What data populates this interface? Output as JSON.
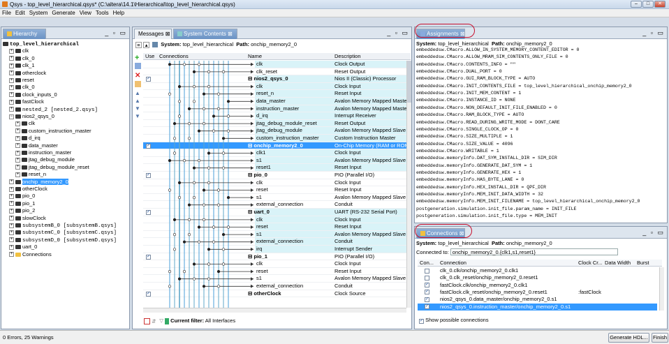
{
  "window": {
    "title": "Qsys - top_level_hierarchical.qsys* (C:\\altera\\14.1\\Hierarchical\\top_level_hierarchical.qsys)",
    "min": "–",
    "max": "□",
    "close": "✕"
  },
  "menu": [
    "File",
    "Edit",
    "System",
    "Generate",
    "View",
    "Tools",
    "Help"
  ],
  "hierarchy": {
    "tab": "Hierarchy",
    "items": [
      {
        "label": "top_level_hierarchical",
        "level": 0,
        "bold": true
      },
      {
        "label": "clk",
        "level": 1
      },
      {
        "label": "clk_0",
        "level": 1
      },
      {
        "label": "clk_1",
        "level": 1
      },
      {
        "label": "otherclock",
        "level": 1
      },
      {
        "label": "reset",
        "level": 1
      },
      {
        "label": "clk_0",
        "level": 1
      },
      {
        "label": "clock_inputs_0",
        "level": 1
      },
      {
        "label": "fastClock",
        "level": 1
      },
      {
        "label": "nested_2 [nested_2.qsys]",
        "level": 1,
        "mono": true
      },
      {
        "label": "nios2_qsys_0",
        "level": 1
      },
      {
        "label": "clk",
        "level": 2
      },
      {
        "label": "custom_instruction_master",
        "level": 2
      },
      {
        "label": "d_irq",
        "level": 2
      },
      {
        "label": "data_master",
        "level": 2
      },
      {
        "label": "instruction_master",
        "level": 2
      },
      {
        "label": "jtag_debug_module",
        "level": 2
      },
      {
        "label": "jtag_debug_module_reset",
        "level": 2
      },
      {
        "label": "reset_n",
        "level": 2
      },
      {
        "label": "onchip_memory2_0",
        "level": 1,
        "selected": true
      },
      {
        "label": "otherClock",
        "level": 1
      },
      {
        "label": "pio_0",
        "level": 1
      },
      {
        "label": "pio_1",
        "level": 1
      },
      {
        "label": "pio_2",
        "level": 1
      },
      {
        "label": "slowClock",
        "level": 1
      },
      {
        "label": "subsystemB_0 [subsystemB.qsys]",
        "level": 1,
        "mono": true
      },
      {
        "label": "subsystemC_0 [subsystemC.qsys]",
        "level": 1,
        "mono": true
      },
      {
        "label": "subsystemD_0 [subsystemD.qsys]",
        "level": 1,
        "mono": true
      },
      {
        "label": "uart_0",
        "level": 1
      },
      {
        "label": "Connections",
        "level": 1
      }
    ]
  },
  "contents": {
    "tab_messages": "Messages",
    "tab_system": "System Contents",
    "system_label": "System:",
    "system_value": "top_level_hierarchical",
    "path_label": "Path:",
    "path_value": "onchip_memory2_0",
    "col_use": "Use",
    "col_connections": "Connections",
    "col_name": "Name",
    "col_description": "Description",
    "rows": [
      {
        "use": "",
        "name": "clk",
        "desc": "Clock Output",
        "indent": true,
        "band": true
      },
      {
        "use": "",
        "name": "clk_reset",
        "desc": "Reset Output",
        "indent": true,
        "band": false
      },
      {
        "use": "✓",
        "name": "nios2_qsys_0",
        "desc": "Nios II (Classic) Processor",
        "bold": true,
        "band": true
      },
      {
        "use": "",
        "name": "clk",
        "desc": "Clock Input",
        "indent": true,
        "band": true
      },
      {
        "use": "",
        "name": "reset_n",
        "desc": "Reset Input",
        "indent": true,
        "band": true
      },
      {
        "use": "",
        "name": "data_master",
        "desc": "Avalon Memory Mapped Master",
        "indent": true,
        "band": true
      },
      {
        "use": "",
        "name": "instruction_master",
        "desc": "Avalon Memory Mapped Master",
        "indent": true,
        "band": true
      },
      {
        "use": "",
        "name": "d_irq",
        "desc": "Interrupt Receiver",
        "indent": true,
        "band": true
      },
      {
        "use": "",
        "name": "jtag_debug_module_reset",
        "desc": "Reset Output",
        "indent": true,
        "band": true
      },
      {
        "use": "",
        "name": "jtag_debug_module",
        "desc": "Avalon Memory Mapped Slave",
        "indent": true,
        "band": true
      },
      {
        "use": "",
        "name": "custom_instruction_master",
        "desc": "Custom Instruction Master",
        "indent": true,
        "band": true
      },
      {
        "use": "✓",
        "name": "onchip_memory2_0",
        "desc": "On-Chip Memory (RAM or ROM)",
        "bold": true,
        "selected": true
      },
      {
        "use": "",
        "name": "clk1",
        "desc": "Clock Input",
        "indent": true,
        "band": true
      },
      {
        "use": "",
        "name": "s1",
        "desc": "Avalon Memory Mapped Slave",
        "indent": true,
        "band": true
      },
      {
        "use": "",
        "name": "reset1",
        "desc": "Reset Input",
        "indent": true,
        "band": true
      },
      {
        "use": "✓",
        "name": "pio_0",
        "desc": "PIO (Parallel I/O)",
        "bold": true,
        "band": false
      },
      {
        "use": "",
        "name": "clk",
        "desc": "Clock Input",
        "indent": true,
        "band": false
      },
      {
        "use": "",
        "name": "reset",
        "desc": "Reset Input",
        "indent": true,
        "band": false
      },
      {
        "use": "",
        "name": "s1",
        "desc": "Avalon Memory Mapped Slave",
        "indent": true,
        "band": false
      },
      {
        "use": "",
        "name": "external_connection",
        "desc": "Conduit",
        "indent": true,
        "band": false
      },
      {
        "use": "✓",
        "name": "uart_0",
        "desc": "UART (RS-232 Serial Port)",
        "bold": true,
        "band": true
      },
      {
        "use": "",
        "name": "clk",
        "desc": "Clock Input",
        "indent": true,
        "band": true
      },
      {
        "use": "",
        "name": "reset",
        "desc": "Reset Input",
        "indent": true,
        "band": true
      },
      {
        "use": "",
        "name": "s1",
        "desc": "Avalon Memory Mapped Slave",
        "indent": true,
        "band": true
      },
      {
        "use": "",
        "name": "external_connection",
        "desc": "Conduit",
        "indent": true,
        "band": true
      },
      {
        "use": "",
        "name": "irq",
        "desc": "Interrupt Sender",
        "indent": true,
        "band": true
      },
      {
        "use": "✓",
        "name": "pio_1",
        "desc": "PIO (Parallel I/O)",
        "bold": true,
        "band": false
      },
      {
        "use": "",
        "name": "clk",
        "desc": "Clock Input",
        "indent": true,
        "band": false
      },
      {
        "use": "",
        "name": "reset",
        "desc": "Reset Input",
        "indent": true,
        "band": false
      },
      {
        "use": "",
        "name": "s1",
        "desc": "Avalon Memory Mapped Slave",
        "indent": true,
        "band": false
      },
      {
        "use": "",
        "name": "external_connection",
        "desc": "Conduit",
        "indent": true,
        "band": false
      },
      {
        "use": "✓",
        "name": "otherClock",
        "desc": "Clock Source",
        "bold": true,
        "band": false
      }
    ],
    "filter_label": "Current filter:",
    "filter_value": "All Interfaces"
  },
  "assignments": {
    "tab": "Assignments",
    "system_label": "System:",
    "system_value": "top_level_hierarchical",
    "path_label": "Path:",
    "path_value": "onchip_memory2_0",
    "lines": [
      "embeddedsw.CMacro.ALLOW_IN_SYSTEM_MEMORY_CONTENT_EDITOR = 0",
      "embeddedsw.CMacro.ALLOW_MRAM_SIM_CONTENTS_ONLY_FILE = 0",
      "embeddedsw.CMacro.CONTENTS_INFO = \"\"",
      "embeddedsw.CMacro.DUAL_PORT = 0",
      "embeddedsw.CMacro.GUI_RAM_BLOCK_TYPE = AUTO",
      "embeddedsw.CMacro.INIT_CONTENTS_FILE = top_level_hierarchical_onchip_memory2_0",
      "embeddedsw.CMacro.INIT_MEM_CONTENT = 1",
      "embeddedsw.CMacro.INSTANCE_ID = NONE",
      "embeddedsw.CMacro.NON_DEFAULT_INIT_FILE_ENABLED = 0",
      "embeddedsw.CMacro.RAM_BLOCK_TYPE = AUTO",
      "embeddedsw.CMacro.READ_DURING_WRITE_MODE = DONT_CARE",
      "embeddedsw.CMacro.SINGLE_CLOCK_OP = 0",
      "embeddedsw.CMacro.SIZE_MULTIPLE = 1",
      "embeddedsw.CMacro.SIZE_VALUE = 4096",
      "embeddedsw.CMacro.WRITABLE = 1",
      "embeddedsw.memoryInfo.DAT_SYM_INSTALL_DIR = SIM_DIR",
      "embeddedsw.memoryInfo.GENERATE_DAT_SYM = 1",
      "embeddedsw.memoryInfo.GENERATE_HEX = 1",
      "embeddedsw.memoryInfo.HAS_BYTE_LANE = 0",
      "embeddedsw.memoryInfo.HEX_INSTALL_DIR = QPF_DIR",
      "embeddedsw.memoryInfo.MEM_INIT_DATA_WIDTH = 32",
      "embeddedsw.memoryInfo.MEM_INIT_FILENAME = top_level_hierarchical_onchip_memory2_0",
      "postgeneration.simulation.init_file.param_name = INIT_FILE",
      "postgeneration.simulation.init_file.type = MEM_INIT"
    ]
  },
  "connections": {
    "tab": "Connections",
    "system_label": "System:",
    "system_value": "top_level_hierarchical",
    "path_label": "Path:",
    "path_value": "onchip_memory2_0",
    "connected_to_label": "Connected to:",
    "connected_to_value": "onchip_memory2_0.{clk1,s1,reset1}",
    "col_con": "Con...",
    "col_connection": "Connection",
    "col_clock": "Clock Cr...",
    "col_width": "Data Width",
    "col_burst": "Burst",
    "rows": [
      {
        "checked": false,
        "connection": "clk_0.clk/onchip_memory2_0.clk1",
        "clock": ""
      },
      {
        "checked": false,
        "connection": "clk_0.clk_reset/onchip_memory2_0.reset1",
        "clock": ""
      },
      {
        "checked": true,
        "connection": "fastClock.clk/onchip_memory2_0.clk1",
        "clock": ""
      },
      {
        "checked": true,
        "connection": "fastClock.clk_reset/onchip_memory2_0.reset1",
        "clock": ":fastClock"
      },
      {
        "checked": true,
        "connection": "nios2_qsys_0.data_master/onchip_memory2_0.s1",
        "clock": ""
      },
      {
        "checked": true,
        "connection": "nios2_qsys_0.instruction_master/onchip_memory2_0.s1",
        "clock": "",
        "selected": true
      }
    ],
    "show_possible": "Show possible connections"
  },
  "status": {
    "messages": "0 Errors, 25 Warnings",
    "generate_btn": "Generate HDL...",
    "finish_btn": "Finish"
  },
  "colors": {
    "selection": "#3399ff",
    "band": "#d9f3f8",
    "highlight_oval": "#c8102e"
  }
}
